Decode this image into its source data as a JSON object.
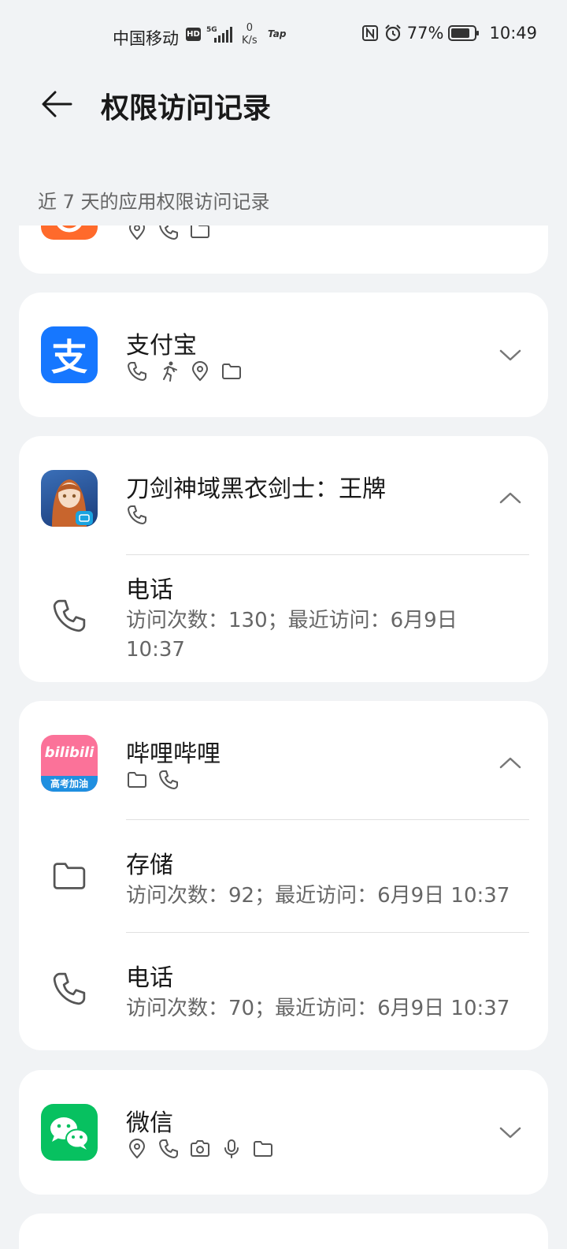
{
  "status_bar": {
    "carrier": "中国移动",
    "hd": "HD",
    "network": "5G",
    "speed_value": "0",
    "speed_unit": "K/s",
    "tap": "Tap",
    "battery": "77%",
    "time": "10:49"
  },
  "header": {
    "title": "权限访问记录"
  },
  "subtitle": "近 7 天的应用权限访问记录",
  "apps": [
    {
      "name": "",
      "permissions": [
        "location-icon",
        "phone-icon",
        "folder-icon"
      ],
      "expanded": false
    },
    {
      "name": "支付宝",
      "permissions": [
        "phone-icon",
        "activity-icon",
        "location-icon",
        "folder-icon"
      ],
      "expanded": false
    },
    {
      "name": "刀剑神域黑衣剑士：王牌",
      "permissions": [
        "phone-icon"
      ],
      "expanded": true,
      "details": [
        {
          "icon": "phone-icon",
          "title": "电话",
          "text_line1": "访问次数：130；最近访问：6月9日",
          "text_line2": "10:37"
        }
      ]
    },
    {
      "name": "哔哩哔哩",
      "permissions": [
        "folder-icon",
        "phone-icon"
      ],
      "expanded": true,
      "details": [
        {
          "icon": "folder-icon",
          "title": "存储",
          "text_line1": "访问次数：92；最近访问：6月9日 10:37"
        },
        {
          "icon": "phone-icon",
          "title": "电话",
          "text_line1": "访问次数：70；最近访问：6月9日 10:37"
        }
      ]
    },
    {
      "name": "微信",
      "permissions": [
        "location-icon",
        "phone-icon",
        "camera-icon",
        "microphone-icon",
        "folder-icon"
      ],
      "expanded": false
    }
  ],
  "icon_labels": {
    "alipay": "支",
    "bilibili_line1": "bilibili",
    "bilibili_line2": "高考加油"
  },
  "colors": {
    "alipay": "#1677ff",
    "wechat": "#07c160",
    "bilibili": "#fb7299"
  }
}
